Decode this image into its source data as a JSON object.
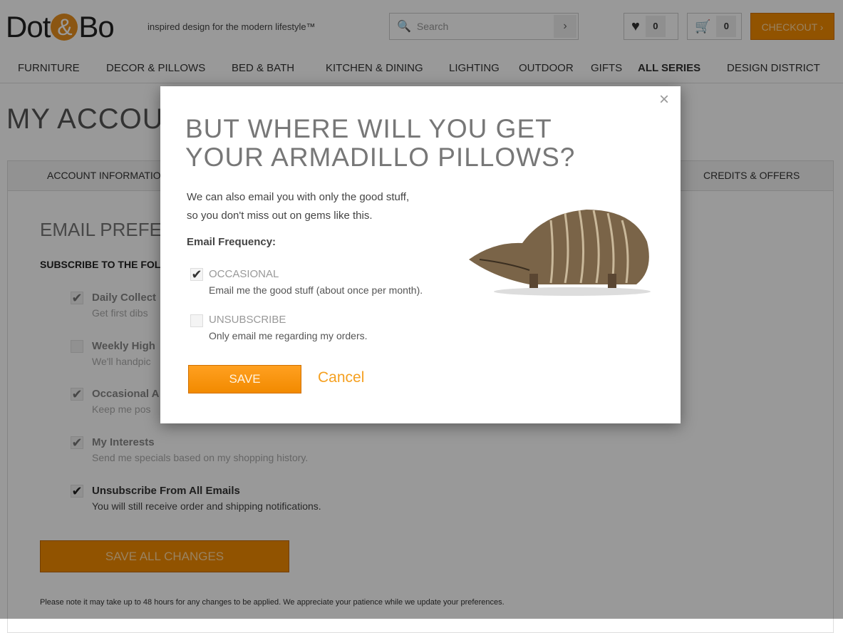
{
  "header": {
    "logo": "Dot&Bo",
    "tagline": "inspired design for the modern lifestyle™",
    "search_placeholder": "Search",
    "wishlist_count": "0",
    "cart_count": "0",
    "checkout_label": "CHECKOUT ›"
  },
  "nav": [
    "FURNITURE",
    "DECOR & PILLOWS",
    "BED & BATH",
    "KITCHEN & DINING",
    "LIGHTING",
    "OUTDOOR",
    "GIFTS",
    "ALL SERIES",
    "DESIGN DISTRICT"
  ],
  "page": {
    "title": "MY ACCOUNT",
    "tabs": [
      "ACCOUNT INFORMATION",
      "CREDITS & OFFERS"
    ],
    "section_title": "EMAIL PREFERENCES",
    "subscribe_heading": "SUBSCRIBE TO THE FOLLOWING:",
    "items": [
      {
        "title": "Daily Collect",
        "desc": "Get first dibs",
        "checked": true
      },
      {
        "title": "Weekly High",
        "desc": "We'll handpic",
        "checked": false
      },
      {
        "title": "Occasional A",
        "desc": "Keep me pos",
        "checked": true
      },
      {
        "title": "My Interests",
        "desc": "Send me specials based on my shopping history.",
        "checked": true
      },
      {
        "title": "Unsubscribe From All Emails",
        "desc": "You will still receive order and shipping notifications.",
        "checked": true
      }
    ],
    "save_all": "SAVE ALL CHANGES",
    "note": "Please note it may take up to 48 hours for any changes to be applied. We appreciate your patience while we update your preferences."
  },
  "modal": {
    "title_line1": "BUT WHERE WILL YOU GET",
    "title_line2": "YOUR ARMADILLO PILLOWS?",
    "text_line1": "We can also email you with only the good stuff,",
    "text_line2": "so you don't miss out on gems like this.",
    "frequency_label": "Email Frequency:",
    "options": [
      {
        "label": "OCCASIONAL",
        "desc": "Email me the good stuff (about once per month).",
        "checked": true
      },
      {
        "label": "UNSUBSCRIBE",
        "desc": "Only email me regarding my orders.",
        "checked": false
      }
    ],
    "save": "SAVE",
    "cancel": "Cancel",
    "close": "×"
  },
  "colors": {
    "accent": "#f28a00",
    "cancel": "#f5a020"
  }
}
